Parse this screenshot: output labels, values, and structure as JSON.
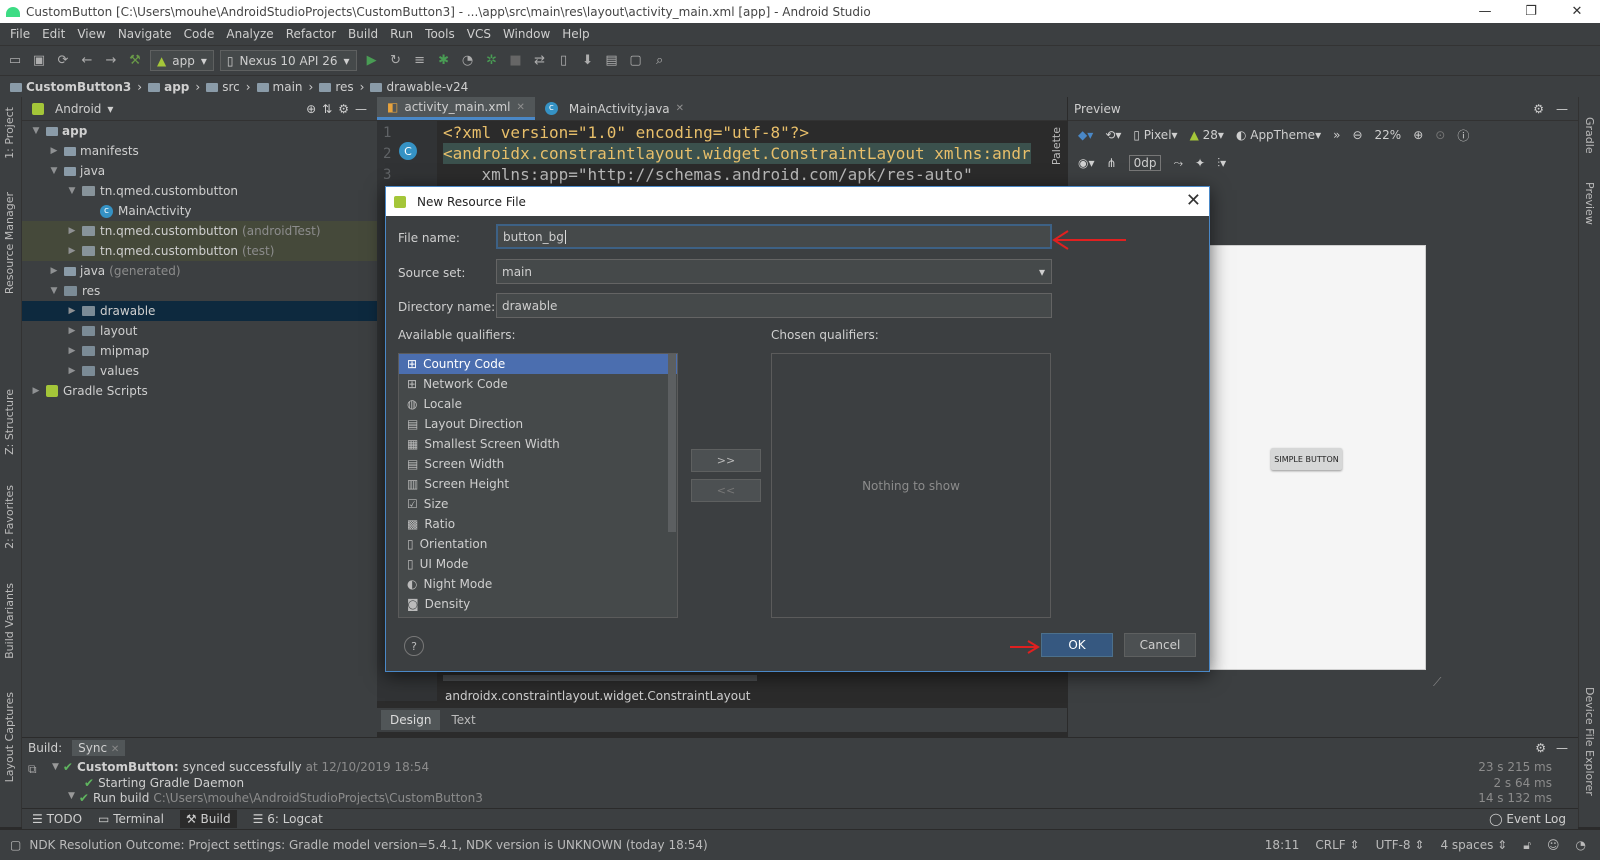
{
  "window": {
    "title": "CustomButton [C:\\Users\\mouhe\\AndroidStudioProjects\\CustomButton3] - ...\\app\\src\\main\\res\\layout\\activity_main.xml [app] - Android Studio"
  },
  "menu": [
    "File",
    "Edit",
    "View",
    "Navigate",
    "Code",
    "Analyze",
    "Refactor",
    "Build",
    "Run",
    "Tools",
    "VCS",
    "Window",
    "Help"
  ],
  "toolbar": {
    "module": "app",
    "device": "Nexus 10 API 26"
  },
  "breadcrumbs": [
    "CustomButton3",
    "app",
    "src",
    "main",
    "res",
    "drawable-v24"
  ],
  "project_panel": {
    "view_mode": "Android",
    "tree": [
      {
        "label": "app",
        "suffix": "",
        "indent": 0,
        "arrow": "▼",
        "icon": "folder"
      },
      {
        "label": "manifests",
        "suffix": "",
        "indent": 1,
        "arrow": "▶",
        "icon": "folder"
      },
      {
        "label": "java",
        "suffix": "",
        "indent": 1,
        "arrow": "▼",
        "icon": "folder"
      },
      {
        "label": "tn.qmed.custombutton",
        "suffix": "",
        "indent": 2,
        "arrow": "▼",
        "icon": "pkg"
      },
      {
        "label": "MainActivity",
        "suffix": "",
        "indent": 3,
        "arrow": "",
        "icon": "java"
      },
      {
        "label": "tn.qmed.custombutton",
        "suffix": "(androidTest)",
        "indent": 2,
        "arrow": "▶",
        "icon": "pkg"
      },
      {
        "label": "tn.qmed.custombutton",
        "suffix": "(test)",
        "indent": 2,
        "arrow": "▶",
        "icon": "pkg"
      },
      {
        "label": "java",
        "suffix": "(generated)",
        "indent": 1,
        "arrow": "▶",
        "icon": "folder"
      },
      {
        "label": "res",
        "suffix": "",
        "indent": 1,
        "arrow": "▼",
        "icon": "res"
      },
      {
        "label": "drawable",
        "suffix": "",
        "indent": 2,
        "arrow": "▶",
        "icon": "res"
      },
      {
        "label": "layout",
        "suffix": "",
        "indent": 2,
        "arrow": "▶",
        "icon": "res"
      },
      {
        "label": "mipmap",
        "suffix": "",
        "indent": 2,
        "arrow": "▶",
        "icon": "res"
      },
      {
        "label": "values",
        "suffix": "",
        "indent": 2,
        "arrow": "▶",
        "icon": "res"
      },
      {
        "label": "Gradle Scripts",
        "suffix": "",
        "indent": 0,
        "arrow": "▶",
        "icon": "green"
      }
    ]
  },
  "editor": {
    "tabs": [
      "activity_main.xml",
      "MainActivity.java"
    ],
    "line_numbers": [
      "1",
      "2",
      "3"
    ],
    "lines": [
      "<?xml version=\"1.0\" encoding=\"utf-8\"?>",
      "<androidx.constraintlayout.widget.ConstraintLayout xmlns:andr",
      "    xmlns:app=\"http://schemas.android.com/apk/res-auto\""
    ],
    "status_path": "androidx.constraintlayout.widget.ConstraintLayout",
    "bottom_tabs": [
      "Design",
      "Text"
    ]
  },
  "preview": {
    "title": "Preview",
    "device": "Pixel",
    "api": "28",
    "theme": "AppTheme",
    "zoom": "22%",
    "margin": "0dp",
    "button_label": "SIMPLE BUTTON"
  },
  "dialog": {
    "title": "New Resource File",
    "file_name_label": "File name:",
    "file_name_value": "button_bg",
    "source_set_label": "Source set:",
    "source_set_value": "main",
    "directory_label": "Directory name:",
    "directory_value": "drawable",
    "available_label": "Available qualifiers:",
    "chosen_label": "Chosen qualifiers:",
    "qualifiers": [
      "Country Code",
      "Network Code",
      "Locale",
      "Layout Direction",
      "Smallest Screen Width",
      "Screen Width",
      "Screen Height",
      "Size",
      "Ratio",
      "Orientation",
      "UI Mode",
      "Night Mode",
      "Density"
    ],
    "nothing_to_show": "Nothing to show",
    "add_button": ">>",
    "remove_button": "<<",
    "ok": "OK",
    "cancel": "Cancel",
    "help": "?"
  },
  "build_panel": {
    "tab_build": "Build:",
    "tab_sync": "Sync",
    "rows": [
      {
        "bold": "CustomButton:",
        "text": " synced successfully",
        "time_prefix": " at 12/10/2019 18:54",
        "duration": "23 s 215 ms"
      },
      {
        "bold": "",
        "text": "Starting Gradle Daemon",
        "time_prefix": "",
        "duration": "2 s 64 ms"
      },
      {
        "bold": "",
        "text": "Run build",
        "time_prefix": " C:\\Users\\mouhe\\AndroidStudioProjects\\CustomButton3",
        "duration": "14 s 132 ms"
      }
    ]
  },
  "bottom_tabs": [
    "TODO",
    "Terminal",
    "Build",
    "6: Logcat"
  ],
  "event_log": "Event Log",
  "status": {
    "message": "NDK Resolution Outcome: Project settings: Gradle model version=5.4.1, NDK version is UNKNOWN (today 18:54)",
    "position": "18:11",
    "line_sep": "CRLF",
    "encoding": "UTF-8",
    "indent": "4 spaces"
  },
  "side_tabs_left": [
    "1: Project",
    "Resource Manager",
    "Z: Structure",
    "2: Favorites",
    "Build Variants",
    "Layout Captures"
  ],
  "side_tabs_right": [
    "Gradle",
    "Preview",
    "Device File Explorer"
  ],
  "palette_tab": "Palette",
  "colors": {
    "accent": "#4a88c7",
    "selection": "#4b6eaf",
    "annotation_red": "#e02020"
  }
}
